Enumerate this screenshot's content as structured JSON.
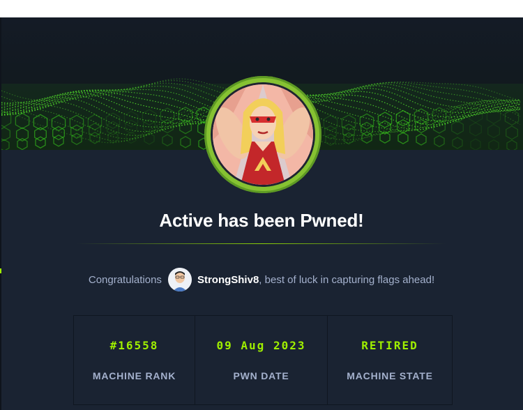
{
  "title": "Active has been Pwned!",
  "congrats": {
    "prefix": "Congratulations",
    "username": "StrongShiv8",
    "suffix": ", best of luck in capturing flags ahead!"
  },
  "stats": [
    {
      "value": "#16558",
      "label": "MACHINE RANK"
    },
    {
      "value": "09 Aug 2023",
      "label": "PWN DATE"
    },
    {
      "value": "RETIRED",
      "label": "MACHINE STATE"
    }
  ],
  "colors": {
    "accent": "#9fef00",
    "background": "#1a2332",
    "text_muted": "#a4b1cd",
    "ring": "#86c232"
  },
  "icons": {
    "banner": "green-cube-wave",
    "machine_avatar": "hero-woman-avatar",
    "user_avatar": "user-avatar-icon"
  }
}
